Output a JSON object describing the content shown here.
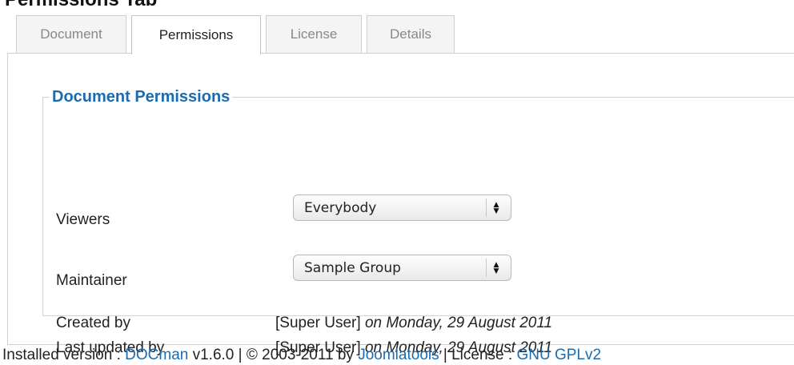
{
  "heading": "Permissions Tab",
  "tabs": [
    {
      "label": "Document",
      "active": false
    },
    {
      "label": "Permissions",
      "active": true
    },
    {
      "label": "License",
      "active": false
    },
    {
      "label": "Details",
      "active": false
    }
  ],
  "permissions": {
    "legend": "Document Permissions",
    "viewers": {
      "label": "Viewers",
      "value": "Everybody"
    },
    "maintainer": {
      "label": "Maintainer",
      "value": "Sample Group"
    },
    "created_by": {
      "label": "Created by",
      "user": "[Super User]",
      "date_text": "on Monday, 29 August 2011"
    },
    "last_updated_by": {
      "label": "Last updated by",
      "user": "[Super User]",
      "date_text": "on Monday, 29 August 2011"
    }
  },
  "footer": {
    "prefix": "Installed version : ",
    "product_link": "DOCman",
    "version": " v1.6.0 | © 2003-2011 by ",
    "company_link": "Joomlatools",
    "license_prefix": " | License : ",
    "license_link": "GNU GPLv2"
  },
  "colors": {
    "link": "#1b6bb0",
    "legend": "#1b6bb0"
  },
  "icons": {
    "select_arrows": "up-down-arrows-icon"
  }
}
